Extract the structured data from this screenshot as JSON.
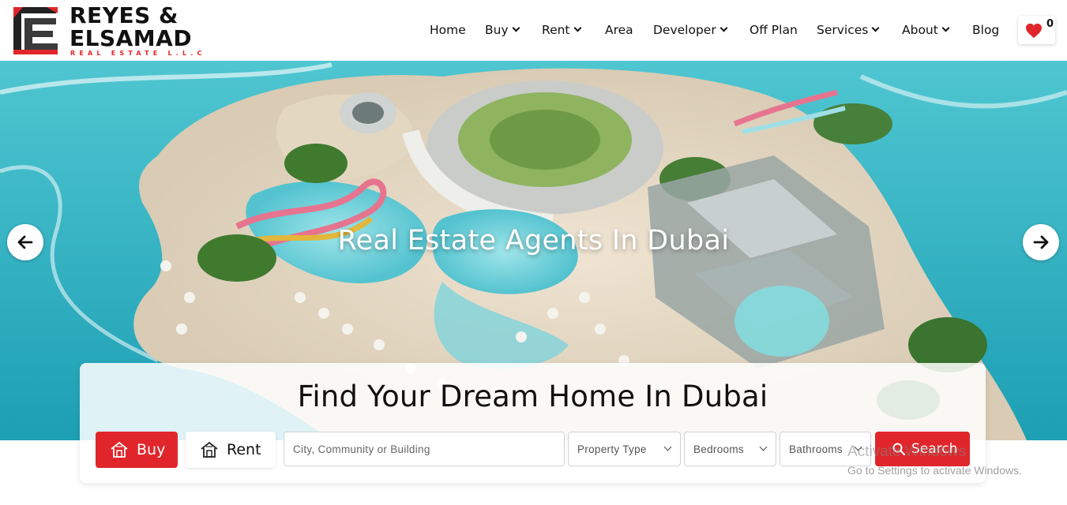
{
  "brand": {
    "name_line1": "REYES &",
    "name_line2": "ELSAMAD",
    "sub": "REAL ESTATE L.L.C",
    "logo_icon": "re-monogram-logo",
    "accent_color": "#e0262b"
  },
  "nav": {
    "items": [
      {
        "label": "Home",
        "has_dropdown": false
      },
      {
        "label": "Buy",
        "has_dropdown": true
      },
      {
        "label": "Rent",
        "has_dropdown": true
      },
      {
        "label": "Area",
        "has_dropdown": false
      },
      {
        "label": "Developer",
        "has_dropdown": true
      },
      {
        "label": "Off Plan",
        "has_dropdown": false
      },
      {
        "label": "Services",
        "has_dropdown": true
      },
      {
        "label": "About",
        "has_dropdown": true
      },
      {
        "label": "Blog",
        "has_dropdown": false
      }
    ],
    "favorites_count": "0",
    "favorites_icon": "heart-icon"
  },
  "hero": {
    "title": "Real Estate Agents In Dubai",
    "prev_icon": "arrow-left-icon",
    "next_icon": "arrow-right-icon",
    "image": "aerial view of island resort with water park"
  },
  "search": {
    "title": "Find Your Dream Home In Dubai",
    "buy_label": "Buy",
    "rent_label": "Rent",
    "location_placeholder": "City, Community or Building",
    "property_type": "Property Type",
    "bedrooms": "Bedrooms",
    "bathrooms": "Bathrooms",
    "search_label": "Search"
  },
  "os_watermark": {
    "line1": "Activate Windows",
    "line2": "Go to Settings to activate Windows."
  }
}
